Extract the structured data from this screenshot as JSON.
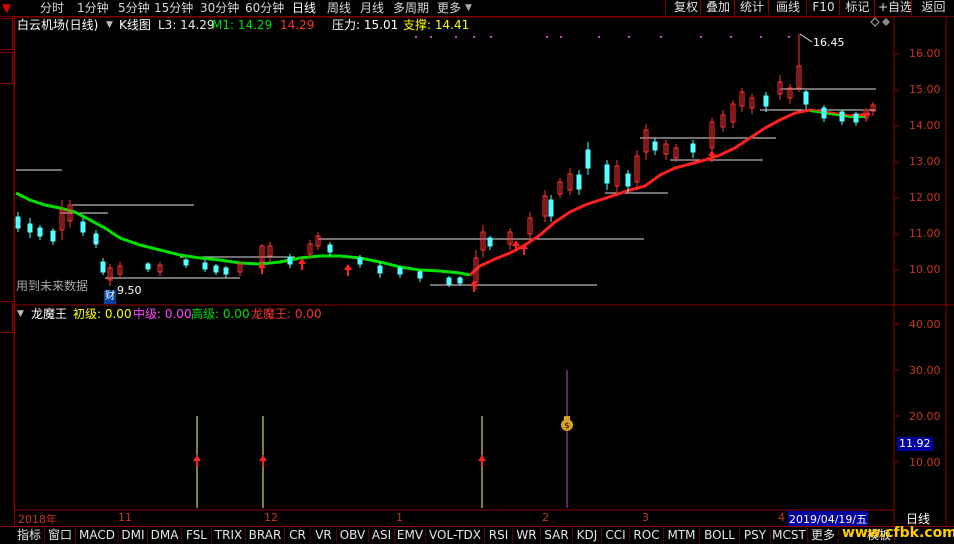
{
  "toolbar": {
    "items": [
      "分时",
      "1分钟",
      "5分钟",
      "15分钟",
      "30分钟",
      "60分钟",
      "日线",
      "周线",
      "月线",
      "多周期",
      "更多"
    ],
    "selected": "日线",
    "right_buttons": [
      "复权",
      "叠加",
      "统计",
      "画线",
      "F10",
      "标记",
      "+自选",
      "返回"
    ]
  },
  "chart_header": {
    "title": "白云机场(日线)",
    "kline_label": "K线图",
    "l3": "L3: 14.29",
    "m1": "M1: 14.29",
    "m2": "14.29",
    "pressure": "压力: 15.01",
    "support": "支撑: 14.41",
    "hint": "用到未来数据",
    "low_marker": "9.50",
    "high_marker": "16.45",
    "cai_badge": "财"
  },
  "price_axis": [
    "16.00",
    "15.00",
    "14.00",
    "13.00",
    "12.00",
    "11.00",
    "10.00"
  ],
  "indicator_header": {
    "name": "龙魔王",
    "a": "初级: 0.00",
    "b": "中级: 0.00",
    "c": "高级: 0.00",
    "d": "龙魔王: 0.00"
  },
  "indicator_axis": [
    "40.00",
    "30.00",
    "20.00",
    "10.00"
  ],
  "indicator_current": "11.92",
  "date_axis": {
    "labels": [
      "2018年",
      "11",
      "12",
      "1",
      "2",
      "3",
      "4"
    ],
    "current_date": "2019/04/19/五",
    "period": "日线"
  },
  "bottom_tabs": [
    "指标",
    "窗口",
    "MACD",
    "DMI",
    "DMA",
    "FSL",
    "TRIX",
    "BRAR",
    "CR",
    "VR",
    "OBV",
    "ASI",
    "EMV",
    "VOL-TDX",
    "RSI",
    "WR",
    "SAR",
    "KDJ",
    "CCI",
    "ROC",
    "MTM",
    "BOLL",
    "PSY",
    "MCST",
    "更多",
    "模板"
  ],
  "watermark": "www.cfbk.com",
  "colors": {
    "up": "#ff3232",
    "down": "#54ffff",
    "ma_green": "#00e000",
    "ma_red": "#ff2020",
    "frame": "#8b0000",
    "axis_text": "#c8361e"
  }
}
